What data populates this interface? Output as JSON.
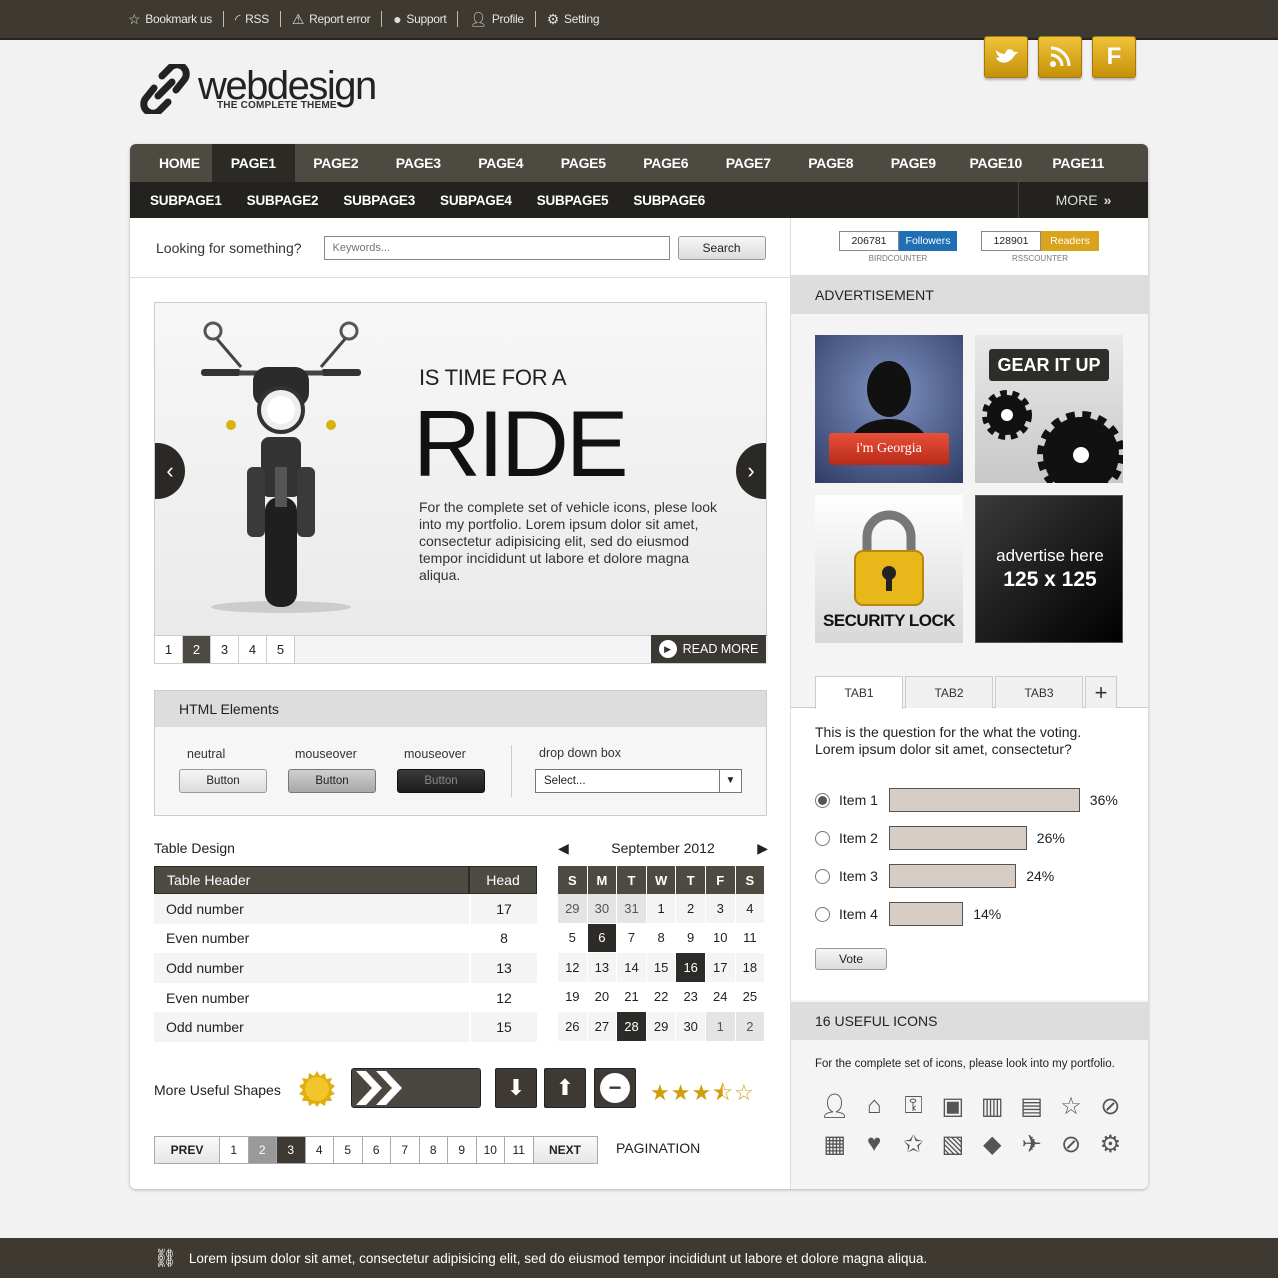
{
  "topbar": {
    "links": [
      {
        "label": "Bookmark us",
        "icon": "star-icon"
      },
      {
        "label": "RSS",
        "icon": "rss-icon"
      },
      {
        "label": "Report error",
        "icon": "warning-icon"
      },
      {
        "label": "Support",
        "icon": "chat-icon"
      },
      {
        "label": "Profile",
        "icon": "user-icon"
      },
      {
        "label": "Setting",
        "icon": "gear-icon"
      }
    ]
  },
  "logo": {
    "brand": "webdesign",
    "tagline": "THE COMPLETE THEME"
  },
  "social": {
    "accent": "#d8a818",
    "buttons": [
      "twitter-icon",
      "rss-icon",
      "facebook-icon"
    ]
  },
  "nav": {
    "pages": [
      "HOME",
      "PAGE1",
      "PAGE2",
      "PAGE3",
      "PAGE4",
      "PAGE5",
      "PAGE6",
      "PAGE7",
      "PAGE8",
      "PAGE9",
      "PAGE10",
      "PAGE11"
    ],
    "active": "PAGE1",
    "subpages": [
      "SUBPAGE1",
      "SUBPAGE2",
      "SUBPAGE3",
      "SUBPAGE4",
      "SUBPAGE5",
      "SUBPAGE6"
    ],
    "more": "MORE"
  },
  "search": {
    "label": "Looking for something?",
    "placeholder": "Keywords...",
    "button": "Search"
  },
  "slider": {
    "kicker": "IS TIME FOR A",
    "headline": "RIDE",
    "description": "For the complete set of vehicle icons, plese look into my portfolio. Lorem ipsum dolor sit amet, consectetur adipisicing elit, sed do eiusmod tempor incididunt ut labore et dolore magna aliqua.",
    "pages": [
      "1",
      "2",
      "3",
      "4",
      "5"
    ],
    "active_page": "2",
    "read_more": "READ MORE"
  },
  "html_elements": {
    "title": "HTML Elements",
    "states": [
      "neutral",
      "mouseover",
      "mouseover"
    ],
    "button": "Button",
    "dropdown_label": "drop down box",
    "dropdown_value": "Select..."
  },
  "table": {
    "title": "Table Design",
    "headers": [
      "Table Header",
      "Head"
    ],
    "rows": [
      [
        "Odd number",
        "17"
      ],
      [
        "Even number",
        "8"
      ],
      [
        "Odd number",
        "13"
      ],
      [
        "Even number",
        "12"
      ],
      [
        "Odd number",
        "15"
      ]
    ]
  },
  "calendar": {
    "month": "September 2012",
    "weekdays": [
      "S",
      "M",
      "T",
      "W",
      "T",
      "F",
      "S"
    ],
    "days": [
      "29",
      "30",
      "31",
      "1",
      "2",
      "3",
      "4",
      "5",
      "6",
      "7",
      "8",
      "9",
      "10",
      "11",
      "12",
      "13",
      "14",
      "15",
      "16",
      "17",
      "18",
      "19",
      "20",
      "21",
      "22",
      "23",
      "24",
      "25",
      "26",
      "27",
      "28",
      "29",
      "30",
      "1",
      "2"
    ],
    "highlighted": [
      "6",
      "16",
      "28"
    ]
  },
  "shapes": {
    "label": "More Useful Shapes",
    "rating": 3.5
  },
  "pagination": {
    "prev": "PREV",
    "next": "NEXT",
    "pages": [
      "1",
      "2",
      "3",
      "4",
      "5",
      "6",
      "7",
      "8",
      "9",
      "10",
      "11"
    ],
    "label": "PAGINATION"
  },
  "counters": {
    "bird": {
      "count": "206781",
      "label": "Followers",
      "sub": "BIRDCOUNTER",
      "color": "#1f6fb5"
    },
    "rss": {
      "count": "128901",
      "label": "Readers",
      "sub": "RSSCOUNTER",
      "color": "#d9a41c"
    }
  },
  "ads": {
    "title": "ADVERTISEMENT",
    "georgia": "i'm Georgia",
    "gear": "GEAR IT UP",
    "lock": "SECURITY LOCK",
    "placeholder_line1": "advertise here",
    "placeholder_line2": "125 x 125"
  },
  "poll": {
    "tabs": [
      "TAB1",
      "TAB2",
      "TAB3"
    ],
    "question": "This is the question for the what the voting. Lorem ipsum dolor sit amet, consectetur?",
    "items": [
      {
        "label": "Item 1",
        "percent": "36%",
        "value": 36
      },
      {
        "label": "Item 2",
        "percent": "26%",
        "value": 26
      },
      {
        "label": "Item 3",
        "percent": "24%",
        "value": 24
      },
      {
        "label": "Item 4",
        "percent": "14%",
        "value": 14
      }
    ],
    "vote": "Vote"
  },
  "icons": {
    "title": "16 USEFUL ICONS",
    "text": "For the complete set of icons, please look into my portfolio.",
    "list": [
      "user-icon",
      "home-icon",
      "key-icon",
      "camera-icon",
      "chart-icon",
      "trash-icon",
      "star-icon",
      "compass-icon",
      "document-icon",
      "heart-icon",
      "star-outline-icon",
      "book-icon",
      "tag-icon",
      "bird-icon",
      "forbidden-icon",
      "gear-icon"
    ]
  },
  "footer": {
    "text": "Lorem ipsum dolor sit amet, consectetur adipisicing elit, sed do eiusmod tempor incididunt ut labore et dolore magna aliqua."
  }
}
